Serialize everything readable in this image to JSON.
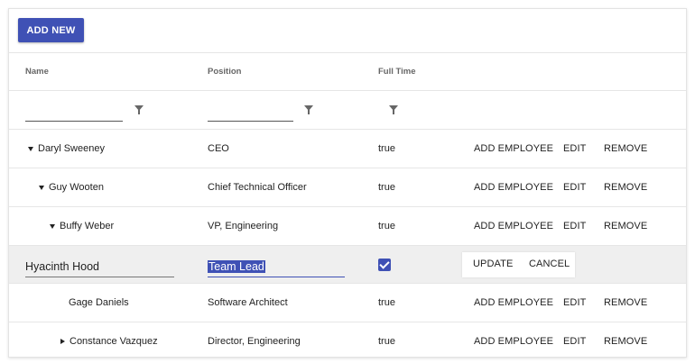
{
  "toolbar": {
    "add_new_label": "ADD NEW"
  },
  "columns": {
    "name": "Name",
    "position": "Position",
    "full_time": "Full Time"
  },
  "actions": {
    "add_employee": "ADD EMPLOYEE",
    "edit": "EDIT",
    "remove": "REMOVE",
    "update": "UPDATE",
    "cancel": "CANCEL"
  },
  "rows": [
    {
      "name": "Daryl Sweeney",
      "position": "CEO",
      "full_time": "true",
      "level": 0,
      "toggle": "expanded"
    },
    {
      "name": "Guy Wooten",
      "position": "Chief Technical Officer",
      "full_time": "true",
      "level": 1,
      "toggle": "expanded"
    },
    {
      "name": "Buffy Weber",
      "position": "VP, Engineering",
      "full_time": "true",
      "level": 2,
      "toggle": "expanded"
    }
  ],
  "edit_row": {
    "name": "Hyacinth Hood",
    "position": "Team Lead",
    "full_time": true
  },
  "rows_after": [
    {
      "name": "Gage Daniels",
      "position": "Software Architect",
      "full_time": "true",
      "level": 3,
      "toggle": "none"
    },
    {
      "name": "Constance Vazquez",
      "position": "Director, Engineering",
      "full_time": "true",
      "level": 3,
      "toggle": "collapsed"
    }
  ],
  "colors": {
    "primary": "#3f51b5",
    "edit_row_bg": "#efefef"
  }
}
